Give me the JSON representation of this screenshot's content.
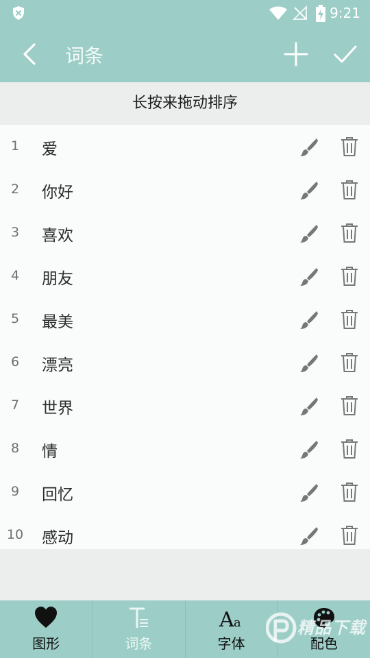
{
  "status_bar": {
    "time": "9:21"
  },
  "toolbar": {
    "title": "词条"
  },
  "hint": "长按来拖动排序",
  "items": [
    {
      "num": "1",
      "word": "爱"
    },
    {
      "num": "2",
      "word": "你好"
    },
    {
      "num": "3",
      "word": "喜欢"
    },
    {
      "num": "4",
      "word": "朋友"
    },
    {
      "num": "5",
      "word": "最美"
    },
    {
      "num": "6",
      "word": "漂亮"
    },
    {
      "num": "7",
      "word": "世界"
    },
    {
      "num": "8",
      "word": "情"
    },
    {
      "num": "9",
      "word": "回忆"
    },
    {
      "num": "10",
      "word": "感动"
    }
  ],
  "tabs": [
    {
      "label": "图形",
      "icon": "heart-icon"
    },
    {
      "label": "词条",
      "icon": "text-icon",
      "active": true
    },
    {
      "label": "字体",
      "icon": "font-icon"
    },
    {
      "label": "配色",
      "icon": "palette-icon"
    }
  ],
  "watermark": "精品下载",
  "colors": {
    "accent": "#9ccdc6",
    "list_bg": "#fafcfb",
    "page_bg": "#eceeee"
  }
}
